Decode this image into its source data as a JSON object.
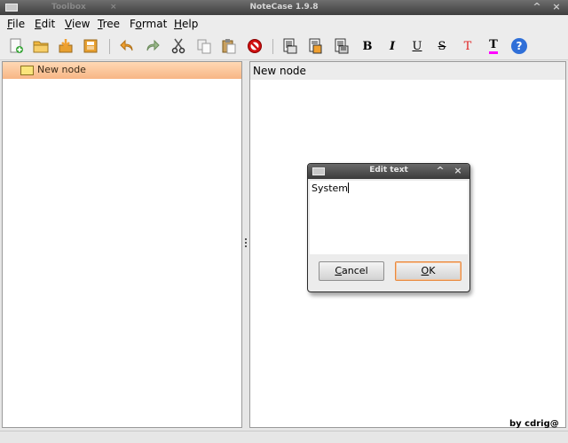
{
  "window": {
    "title": "NoteCase 1.9.8",
    "background_tab_label": "Toolbox",
    "background_tab_close": "×",
    "minimize_glyph": "^",
    "close_glyph": "×"
  },
  "menu": {
    "items": [
      {
        "label": "File",
        "mnemonic": "F",
        "rest": "ile"
      },
      {
        "label": "Edit",
        "mnemonic": "E",
        "rest": "dit"
      },
      {
        "label": "View",
        "mnemonic": "V",
        "rest": "iew"
      },
      {
        "label": "Tree",
        "mnemonic": "T",
        "rest": "ree"
      },
      {
        "label": "Format",
        "mnemonic": "o",
        "pre": "F",
        "rest": "rmat"
      },
      {
        "label": "Help",
        "mnemonic": "H",
        "rest": "elp"
      }
    ]
  },
  "toolbar": {
    "buttons": [
      "new-document-icon",
      "open-folder-icon",
      "save-icon",
      "save-as-icon",
      "undo-icon",
      "redo-icon",
      "cut-icon",
      "copy-icon",
      "paste-icon",
      "delete-icon",
      "node-new-icon",
      "node-move-icon",
      "node-properties-icon",
      "bold-icon",
      "italic-icon",
      "underline-icon",
      "strikethrough-icon",
      "text-color-icon",
      "highlight-color-icon",
      "help-icon"
    ],
    "format_glyphs": {
      "bold": "B",
      "italic": "I",
      "underline": "U",
      "strike": "S",
      "text_color": "T",
      "highlight_color": "T",
      "help": "?"
    },
    "colors": {
      "accent_orange": "#f0a030",
      "delete_red": "#d01010",
      "help_blue": "#2f6fd8",
      "text_color_red": "#e02020",
      "highlight_bar": "#ff00ff"
    }
  },
  "tree": {
    "selected_node": "New node",
    "selection_color": "#f9c49a"
  },
  "note": {
    "title": "New node"
  },
  "dialog": {
    "title": "Edit text",
    "text_value": "System",
    "minimize_glyph": "^",
    "close_glyph": "×",
    "cancel_mnemonic": "C",
    "cancel_rest": "ancel",
    "ok_mnemonic": "O",
    "ok_rest": "K"
  },
  "watermark": "by cdrig@"
}
